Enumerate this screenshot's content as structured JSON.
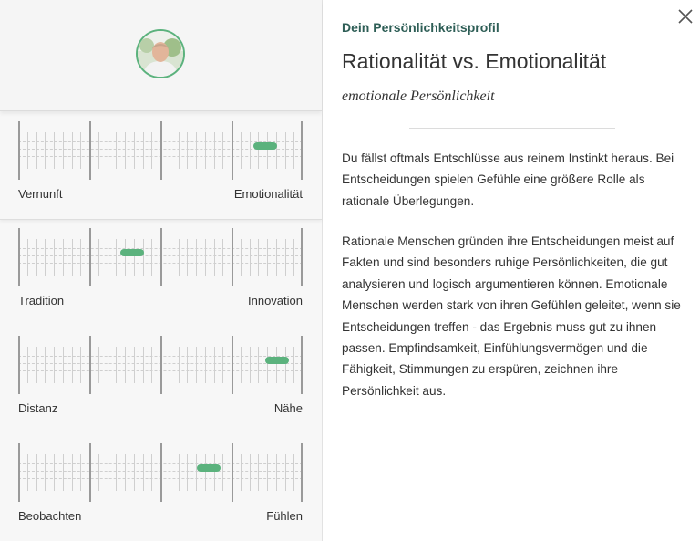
{
  "profile": {
    "eyebrow": "Dein Persönlichkeitsprofil",
    "title": "Rationalität vs. Emotionalität",
    "subtitle": "emotionale Persönlichkeit",
    "paragraphs": [
      "Du fällst oftmals Entschlüsse aus reinem Instinkt heraus. Bei Entscheidungen spielen Gefühle eine größere Rolle als rationale Überlegungen.",
      "Rationale Menschen gründen ihre Entscheidungen meist auf Fakten und sind besonders ruhige Persönlichkeiten, die gut analysieren und logisch argumentieren können. Emotionale Menschen werden stark von ihren Gefühlen geleitet, wenn sie Entscheidungen treffen - das Ergebnis muss gut zu ihnen passen. Empfindsamkeit, Einfühlungsvermögen und die Fähigkeit, Stimmungen zu erspüren, zeichnen ihre Persönlichkeit aus."
    ]
  },
  "scales": [
    {
      "left": "Vernunft",
      "right": "Emotionalität",
      "value": 0.87,
      "selected": true
    },
    {
      "left": "Tradition",
      "right": "Innovation",
      "value": 0.4
    },
    {
      "left": "Distanz",
      "right": "Nähe",
      "value": 0.91
    },
    {
      "left": "Beobachten",
      "right": "Fühlen",
      "value": 0.67
    }
  ],
  "colors": {
    "accent": "#5bb27d",
    "eyebrow": "#2e5e56",
    "text": "#333333"
  },
  "icons": {
    "close": "close-icon",
    "avatar": "avatar"
  }
}
